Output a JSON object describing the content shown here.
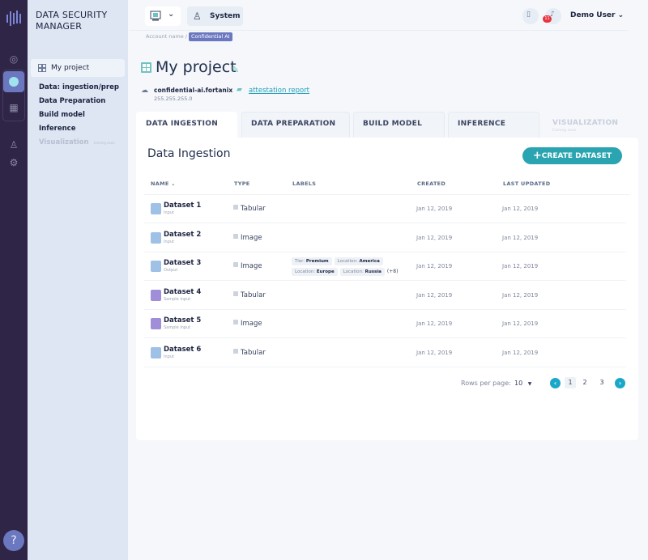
{
  "app": {
    "title": "DATA SECURITY MANAGER"
  },
  "rail": {
    "icons": [
      "dashboard-icon",
      "ai-brain-icon",
      "grid-icon",
      "user-doc-icon",
      "settings-icon"
    ],
    "help_icon": "?"
  },
  "sidebar": {
    "project": "My project",
    "items": [
      {
        "label": "Data: ingestion/prep",
        "disabled": false
      },
      {
        "label": "Data Preparation",
        "disabled": false
      },
      {
        "label": "Build model",
        "disabled": false
      },
      {
        "label": "Inference",
        "disabled": false
      },
      {
        "label": "Visualization",
        "disabled": true,
        "note": "Coming soon"
      }
    ]
  },
  "header": {
    "system_label": "System",
    "notification_count": "11",
    "user_name": "Demo User"
  },
  "breadcrumb": {
    "root": "Account name /",
    "current": "Confidential AI"
  },
  "project": {
    "title": "My project",
    "host": "confidential-ai.fortanix",
    "ip": "255.255.255.0",
    "attestation_link": "attestation report"
  },
  "tabs": [
    {
      "label": "DATA INGESTION",
      "active": true
    },
    {
      "label": "DATA PREPARATION"
    },
    {
      "label": "BUILD MODEL"
    },
    {
      "label": "INFERENCE"
    },
    {
      "label": "VISUALIZATION",
      "disabled": true,
      "note": "Coming soon"
    }
  ],
  "panel": {
    "title": "Data Ingestion",
    "create_button": "CREATE DATASET",
    "columns": [
      "NAME",
      "TYPE",
      "LABELS",
      "CREATED",
      "LAST UPDATED"
    ],
    "rows": [
      {
        "name": "Dataset 1",
        "sub": "Input",
        "type": "Tabular",
        "created": "Jan 12, 2019",
        "updated": "Jan 12, 2019",
        "icon_color": "#9fc1e6"
      },
      {
        "name": "Dataset 2",
        "sub": "Input",
        "type": "Image",
        "created": "Jan 12, 2019",
        "updated": "Jan 12, 2019",
        "icon_color": "#9fc1e6"
      },
      {
        "name": "Dataset 3",
        "sub": "Output",
        "type": "Image",
        "created": "Jan 12, 2019",
        "updated": "Jan 12, 2019",
        "icon_color": "#9fc1e6",
        "labels": [
          {
            "k": "Tier:",
            "v": "Premium"
          },
          {
            "k": "Location:",
            "v": "America"
          },
          {
            "k": "Location:",
            "v": "Europe"
          },
          {
            "k": "Location:",
            "v": "Russia"
          }
        ],
        "more": "(+8)"
      },
      {
        "name": "Dataset 4",
        "sub": "Sample input",
        "type": "Tabular",
        "created": "Jan 12, 2019",
        "updated": "Jan 12, 2019",
        "icon_color": "#a08fd8"
      },
      {
        "name": "Dataset 5",
        "sub": "Sample input",
        "type": "Image",
        "created": "Jan 12, 2019",
        "updated": "Jan 12, 2019",
        "icon_color": "#a08fd8"
      },
      {
        "name": "Dataset 6",
        "sub": "Input",
        "type": "Tabular",
        "created": "Jan 12, 2019",
        "updated": "Jan 12, 2019",
        "icon_color": "#9fc1e6"
      }
    ],
    "pagination": {
      "rows_label": "Rows per page:",
      "rows_value": "10",
      "pages": [
        "1",
        "2",
        "3"
      ],
      "current": "1"
    }
  },
  "colors": {
    "accent": "#2aa4b0",
    "rail": "#2e2547",
    "active": "#6b78bf",
    "badge": "#e6333f"
  }
}
